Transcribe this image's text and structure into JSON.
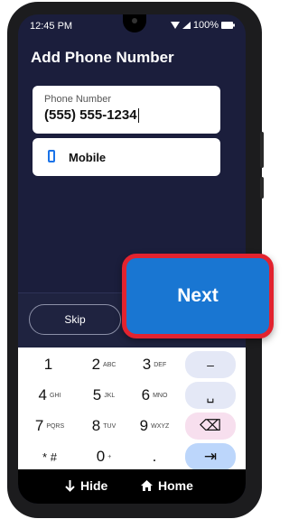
{
  "status_bar": {
    "time": "12:45 PM",
    "battery": "100%"
  },
  "page": {
    "title": "Add Phone Number"
  },
  "phone_field": {
    "label": "Phone Number",
    "value": "(555) 555-1234"
  },
  "type_field": {
    "value": "Mobile",
    "icon": "smartphone-icon"
  },
  "actions": {
    "skip": "Skip",
    "next": "Next"
  },
  "keypad": {
    "rows": [
      [
        {
          "main": "1",
          "sub": ""
        },
        {
          "main": "2",
          "sub": "ABC"
        },
        {
          "main": "3",
          "sub": "DEF"
        },
        {
          "main": "–",
          "sub": ""
        }
      ],
      [
        {
          "main": "4",
          "sub": "GHI"
        },
        {
          "main": "5",
          "sub": "JKL"
        },
        {
          "main": "6",
          "sub": "MNO"
        },
        {
          "main": "␣",
          "sub": ""
        }
      ],
      [
        {
          "main": "7",
          "sub": "PQRS"
        },
        {
          "main": "8",
          "sub": "TUV"
        },
        {
          "main": "9",
          "sub": "WXYZ"
        },
        {
          "main": "⌫",
          "sub": ""
        }
      ],
      [
        {
          "main": "* #",
          "sub": ""
        },
        {
          "main": "0",
          "sub": "+"
        },
        {
          "main": ".",
          "sub": ""
        },
        {
          "main": "⇥",
          "sub": ""
        }
      ]
    ]
  },
  "nav": {
    "hide": "Hide",
    "home": "Home"
  },
  "colors": {
    "accent": "#1976d2",
    "highlight_border": "#e2232f",
    "background": "#1b1e3c"
  }
}
